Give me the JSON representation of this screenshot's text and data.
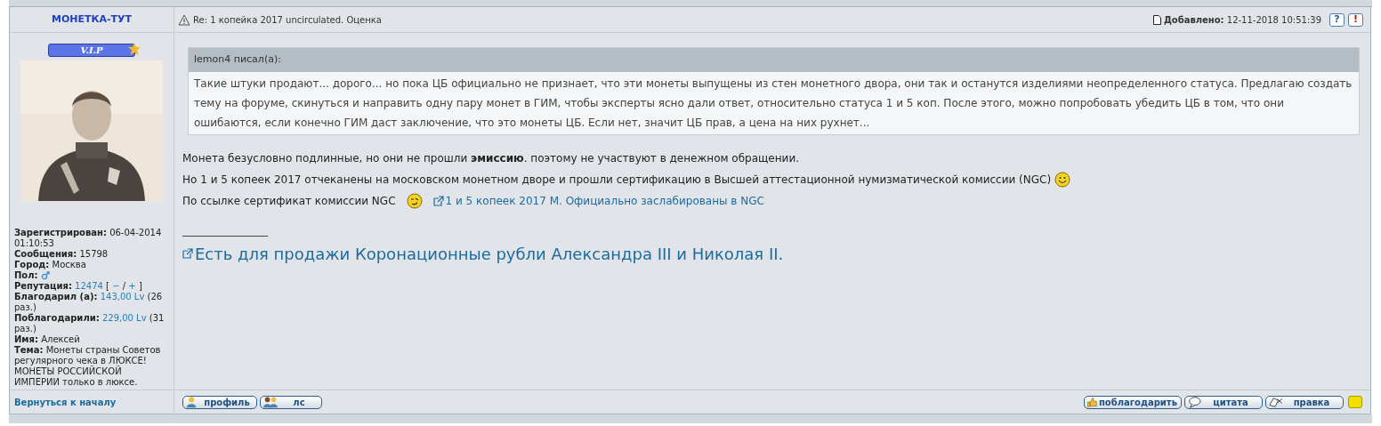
{
  "post": {
    "author": "МОНЕТКА-ТУТ",
    "subject": "Re: 1 копейка 2017 uncirculated. Оценка",
    "added_label": "Добавлено:",
    "added_value": "12-11-2018 10:51:39",
    "header_buttons": [
      "?",
      "!"
    ],
    "rank_badge": "V.I.P",
    "avatar": {
      "kind": "picture"
    },
    "profile": [
      {
        "label": "Зарегистрирован:",
        "parts": [
          {
            "kind": "plain",
            "text": "06-04-2014 01:10:53"
          }
        ]
      },
      {
        "label": "Сообщения:",
        "parts": [
          {
            "kind": "plain",
            "text": "15798"
          }
        ]
      },
      {
        "label": "Город:",
        "parts": [
          {
            "kind": "plain",
            "text": "Москва"
          }
        ]
      },
      {
        "label": "Пол:",
        "parts": [
          {
            "kind": "male-icon"
          }
        ]
      },
      {
        "label": "Репутация:",
        "parts": [
          {
            "kind": "link",
            "text": "12474"
          },
          {
            "kind": "plain",
            "text": "["
          },
          {
            "kind": "link",
            "text": "−"
          },
          {
            "kind": "plain",
            "text": "/"
          },
          {
            "kind": "link",
            "text": "+"
          },
          {
            "kind": "plain",
            "text": "]"
          }
        ]
      },
      {
        "label": "Благодарил (а):",
        "parts": [
          {
            "kind": "link",
            "text": "143,00 Lv"
          },
          {
            "kind": "plain",
            "text": "(26 раз.)"
          }
        ]
      },
      {
        "label": "Поблагодарили:",
        "parts": [
          {
            "kind": "link",
            "text": "229,00 Lv"
          },
          {
            "kind": "plain",
            "text": "(31 раз.)"
          }
        ]
      },
      {
        "label": "Имя:",
        "parts": [
          {
            "kind": "plain",
            "text": "Алексей"
          }
        ]
      },
      {
        "label": "Тема:",
        "parts": [
          {
            "kind": "plain",
            "text": "Монеты страны Советов регулярного чека в ЛЮКСЕ! МОНЕТЫ РОССИЙСКОЙ ИМПЕРИИ только в люксе."
          }
        ]
      }
    ],
    "quote": {
      "author": "lemon4 писал(а):",
      "text": "Такие штуки продают... дорого... но пока ЦБ официально не признает, что эти монеты выпущены из стен монетного двора, они так и останутся изделиями неопределенного статуса. Предлагаю создать тему на форуме, скинуться и направить одну пару монет в ГИМ, чтобы эксперты ясно дали ответ, относительно статуса 1 и 5 коп. После этого, можно попробовать убедить ЦБ в том, что они ошибаются, если конечно ГИМ даст заключение, что это монеты ЦБ. Если нет, значит ЦБ прав, а цена на них рухнет..."
    },
    "lines": [
      {
        "kind": "text",
        "text": "Монета безусловно подлинные, но они не прошли **эмиссию**. поэтому не участвуют в денежном обращении."
      },
      {
        "kind": "text-smiley",
        "text": "Но 1 и 5 копеек 2017 отчеканены на московском монетном дворе и прошли сертификацию в Высшей аттестационной нумизматической комиссии (NGC)"
      },
      {
        "kind": "text-smiley-link",
        "text": "По ссылке сертификат комиссии NGC",
        "link": "1 и 5 копеек 2017 М. Официально заслабированы в NGC"
      }
    ],
    "signature": {
      "rule": "________________",
      "link": "Есть для продажи Коронационные рубли Александра III и Николая II."
    },
    "back_link": "Вернуться к началу",
    "left_buttons": [
      {
        "kind": "profile",
        "label": "профиль"
      },
      {
        "kind": "pm",
        "label": "лс"
      }
    ],
    "right_buttons": [
      {
        "kind": "thanks",
        "label": "поблагодарить"
      },
      {
        "kind": "quote",
        "label": "цитата"
      },
      {
        "kind": "edit",
        "label": "правка"
      }
    ]
  }
}
